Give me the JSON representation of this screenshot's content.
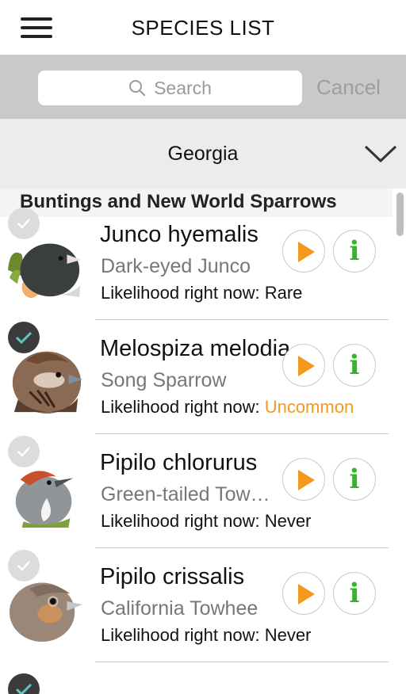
{
  "header": {
    "title": "SPECIES LIST",
    "menu_icon": "hamburger-menu-icon"
  },
  "search": {
    "placeholder": "Search",
    "cancel_label": "Cancel",
    "icon": "search-icon"
  },
  "region": {
    "selected": "Georgia",
    "icon": "chevron-down-icon"
  },
  "section": {
    "title": "Buntings and New World Sparrows"
  },
  "species": [
    {
      "scientific": "Junco hyemalis",
      "common": "Dark-eyed Junco",
      "likelihood_label": "Likelihood right now:",
      "likelihood": "Rare",
      "checked": false
    },
    {
      "scientific": "Melospiza melodia",
      "common": "Song Sparrow",
      "likelihood_label": "Likelihood right now:",
      "likelihood": "Uncommon",
      "checked": true
    },
    {
      "scientific": "Pipilo chlorurus",
      "common": "Green-tailed Tow…",
      "likelihood_label": "Likelihood right now:",
      "likelihood": "Never",
      "checked": false
    },
    {
      "scientific": "Pipilo crissalis",
      "common": "California Towhee",
      "likelihood_label": "Likelihood right now:",
      "likelihood": "Never",
      "checked": false
    }
  ],
  "colors": {
    "accent_orange": "#f39a1e",
    "info_green": "#33b52c",
    "check_teal": "#5ec7c0"
  },
  "info_glyph": "i"
}
